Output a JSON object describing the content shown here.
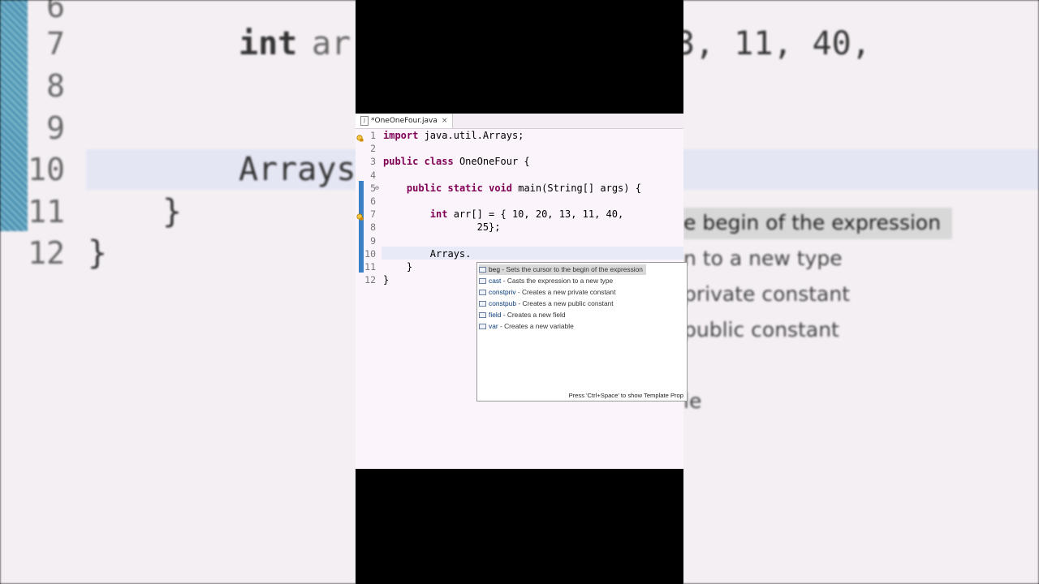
{
  "background": {
    "line_numbers": [
      "6",
      "7",
      "8",
      "9",
      "10",
      "11",
      "12"
    ],
    "code_fragments": [
      "int ",
      "ar",
      "3, 11, 40,",
      "Arrays",
      "}",
      "}"
    ],
    "proposals": [
      "e begin of the expression",
      "n to a new type",
      "private constant",
      "public constant",
      "le"
    ]
  },
  "editor": {
    "tab_title": "*OneOneFour.java",
    "tab_close": "×",
    "fold_glyph": "⊖",
    "lines": [
      {
        "num": "1",
        "tokens": [
          {
            "t": "import",
            "kw": true
          },
          {
            "t": " java.util.Arrays;",
            "kw": false
          }
        ]
      },
      {
        "num": "2",
        "tokens": []
      },
      {
        "num": "3",
        "tokens": [
          {
            "t": "public",
            "kw": true
          },
          {
            "t": " ",
            "kw": false
          },
          {
            "t": "class",
            "kw": true
          },
          {
            "t": " OneOneFour {",
            "kw": false
          }
        ]
      },
      {
        "num": "4",
        "tokens": []
      },
      {
        "num": "5",
        "tokens": [
          {
            "t": "    ",
            "kw": false
          },
          {
            "t": "public",
            "kw": true
          },
          {
            "t": " ",
            "kw": false
          },
          {
            "t": "static",
            "kw": true
          },
          {
            "t": " ",
            "kw": false
          },
          {
            "t": "void",
            "kw": true
          },
          {
            "t": " main(String[] args) {",
            "kw": false
          }
        ]
      },
      {
        "num": "6",
        "tokens": []
      },
      {
        "num": "7",
        "tokens": [
          {
            "t": "        ",
            "kw": false
          },
          {
            "t": "int",
            "kw": true
          },
          {
            "t": " arr[] = { 10, 20, 13, 11, 40,",
            "kw": false
          }
        ]
      },
      {
        "num": "8",
        "tokens": [
          {
            "t": "                25};",
            "kw": false
          }
        ]
      },
      {
        "num": "9",
        "tokens": []
      },
      {
        "num": "10",
        "tokens": [
          {
            "t": "        Arrays.",
            "kw": false
          }
        ]
      },
      {
        "num": "11",
        "tokens": [
          {
            "t": "    }",
            "kw": false
          }
        ]
      },
      {
        "num": "12",
        "tokens": [
          {
            "t": "}",
            "kw": false
          }
        ]
      }
    ]
  },
  "popup": {
    "items": [
      {
        "name": "beg",
        "desc": " - Sets the cursor to the begin of the expression",
        "selected": true
      },
      {
        "name": "cast",
        "desc": " - Casts the expression to a new type",
        "selected": false
      },
      {
        "name": "constpriv",
        "desc": " - Creates a new private constant",
        "selected": false
      },
      {
        "name": "constpub",
        "desc": " - Creates a new public constant",
        "selected": false
      },
      {
        "name": "field",
        "desc": " - Creates a new field",
        "selected": false
      },
      {
        "name": "var",
        "desc": " - Creates a new variable",
        "selected": false
      }
    ],
    "footer": "Press 'Ctrl+Space' to show Template Prop"
  },
  "colors": {
    "keyword": "#7f0055",
    "selection": "#d9d9d9",
    "current_line": "#e8eaf7",
    "ruler_mark": "#3b7fc4"
  }
}
